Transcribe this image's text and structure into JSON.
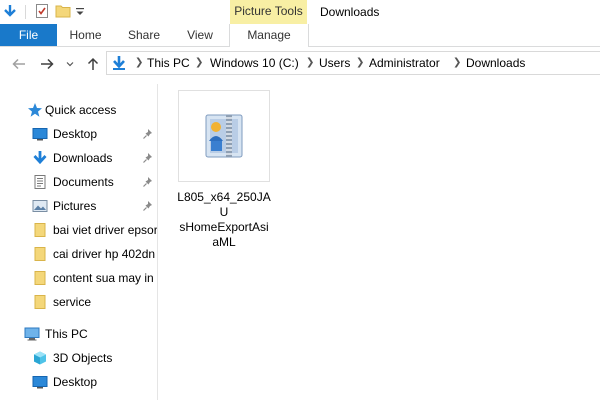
{
  "window": {
    "title": "Downloads",
    "context_tab_group": "Picture Tools"
  },
  "quick_access_toolbar": {
    "icons": [
      "explorer-icon",
      "properties-icon",
      "new-folder-icon",
      "customize-dropdown-icon"
    ]
  },
  "ribbon": {
    "tabs": [
      {
        "label": "File",
        "active": false,
        "style": "file-blue"
      },
      {
        "label": "Home"
      },
      {
        "label": "Share"
      },
      {
        "label": "View"
      },
      {
        "label": "Manage",
        "contextual": true
      }
    ]
  },
  "address_bar": {
    "breadcrumb": [
      "This PC",
      "Windows 10 (C:)",
      "Users",
      "Administrator",
      "Downloads"
    ]
  },
  "nav_pane": {
    "quick_access": {
      "label": "Quick access",
      "items": [
        {
          "label": "Desktop",
          "icon": "desktop-icon",
          "pinned": true
        },
        {
          "label": "Downloads",
          "icon": "downloads-icon",
          "pinned": true
        },
        {
          "label": "Documents",
          "icon": "documents-icon",
          "pinned": true
        },
        {
          "label": "Pictures",
          "icon": "pictures-icon",
          "pinned": true
        },
        {
          "label": "bai viet driver epsor",
          "icon": "folder-icon",
          "pinned": false
        },
        {
          "label": "cai driver hp 402dn",
          "icon": "folder-icon",
          "pinned": false
        },
        {
          "label": "content sua may in",
          "icon": "folder-icon",
          "pinned": false
        },
        {
          "label": "service",
          "icon": "folder-icon",
          "pinned": false
        }
      ]
    },
    "this_pc": {
      "label": "This PC",
      "items": [
        {
          "label": "3D Objects",
          "icon": "3d-objects-icon"
        },
        {
          "label": "Desktop",
          "icon": "desktop-icon"
        }
      ]
    }
  },
  "content": {
    "files": [
      {
        "name": "L805_x64_250JAUsHomeExportAsiaML",
        "name_lines": [
          "L805_x64_250JAU",
          "sHomeExportAsi",
          "aML"
        ],
        "icon": "winzip-archive-icon"
      }
    ]
  },
  "colors": {
    "file_tab": "#1979ca",
    "context_tab": "#f8efa4",
    "accent_blue": "#1e7fd7",
    "folder_yellow": "#f4d77a"
  }
}
